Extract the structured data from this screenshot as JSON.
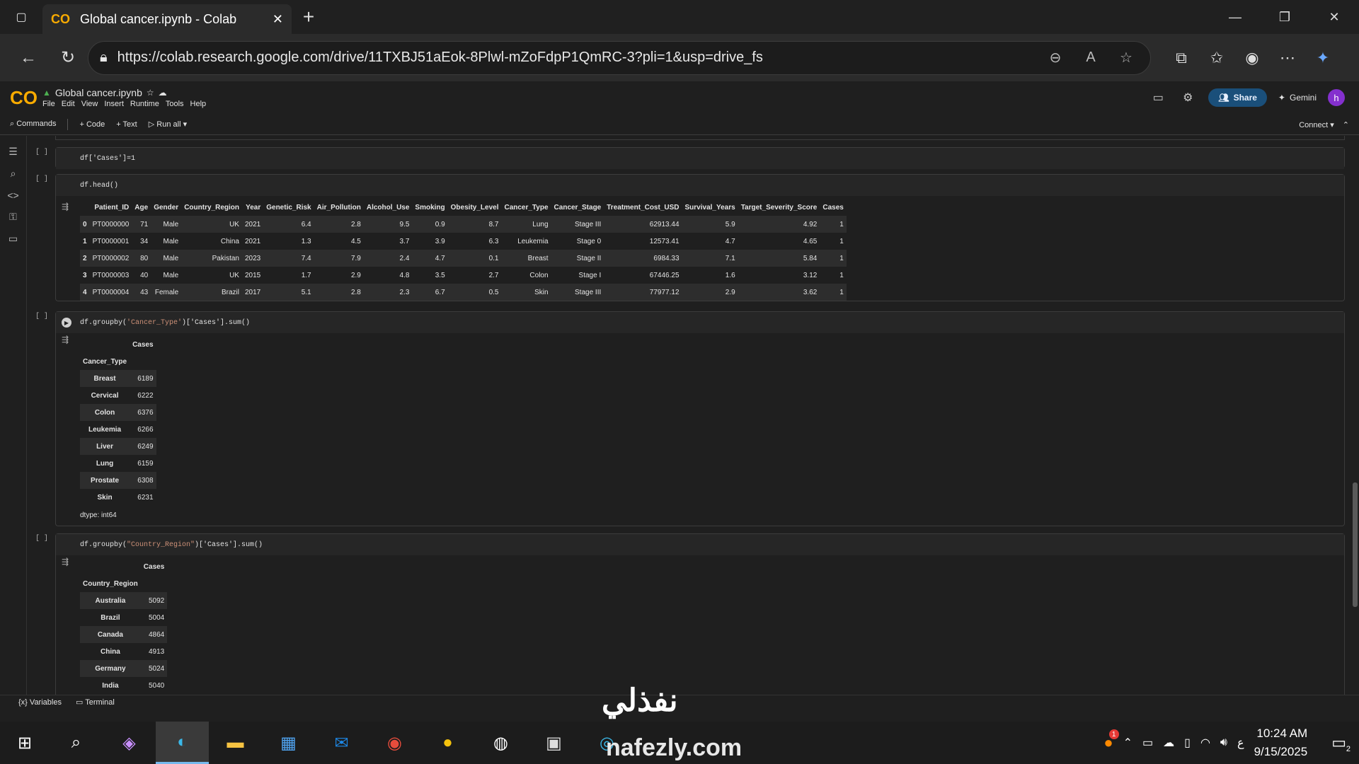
{
  "browser": {
    "tab_title": "Global cancer.ipynb - Colab",
    "url": "https://colab.research.google.com/drive/11TXBJ51aEok-8Plwl-mZoFdpP1QmRC-3?pli=1&usp=drive_fs"
  },
  "colab": {
    "notebook_name": "Global cancer.ipynb",
    "menus": [
      "File",
      "Edit",
      "View",
      "Insert",
      "Runtime",
      "Tools",
      "Help"
    ],
    "share_label": "Share",
    "gemini_label": "Gemini",
    "avatar_letter": "h",
    "toolbar": {
      "commands": "Commands",
      "code": "+ Code",
      "text": "+ Text",
      "run_all": "Run all",
      "connect": "Connect"
    }
  },
  "cells": {
    "c1": {
      "bracket": "[ ]",
      "code": "df['Cases']=1"
    },
    "c2": {
      "bracket": "[ ]",
      "code": "df.head()",
      "columns": [
        "",
        "Patient_ID",
        "Age",
        "Gender",
        "Country_Region",
        "Year",
        "Genetic_Risk",
        "Air_Pollution",
        "Alcohol_Use",
        "Smoking",
        "Obesity_Level",
        "Cancer_Type",
        "Cancer_Stage",
        "Treatment_Cost_USD",
        "Survival_Years",
        "Target_Severity_Score",
        "Cases"
      ],
      "rows": [
        [
          "0",
          "PT0000000",
          "71",
          "Male",
          "UK",
          "2021",
          "6.4",
          "2.8",
          "9.5",
          "0.9",
          "8.7",
          "Lung",
          "Stage III",
          "62913.44",
          "5.9",
          "4.92",
          "1"
        ],
        [
          "1",
          "PT0000001",
          "34",
          "Male",
          "China",
          "2021",
          "1.3",
          "4.5",
          "3.7",
          "3.9",
          "6.3",
          "Leukemia",
          "Stage 0",
          "12573.41",
          "4.7",
          "4.65",
          "1"
        ],
        [
          "2",
          "PT0000002",
          "80",
          "Male",
          "Pakistan",
          "2023",
          "7.4",
          "7.9",
          "2.4",
          "4.7",
          "0.1",
          "Breast",
          "Stage II",
          "6984.33",
          "7.1",
          "5.84",
          "1"
        ],
        [
          "3",
          "PT0000003",
          "40",
          "Male",
          "UK",
          "2015",
          "1.7",
          "2.9",
          "4.8",
          "3.5",
          "2.7",
          "Colon",
          "Stage I",
          "67446.25",
          "1.6",
          "3.12",
          "1"
        ],
        [
          "4",
          "PT0000004",
          "43",
          "Female",
          "Brazil",
          "2017",
          "5.1",
          "2.8",
          "2.3",
          "6.7",
          "0.5",
          "Skin",
          "Stage III",
          "77977.12",
          "2.9",
          "3.62",
          "1"
        ]
      ]
    },
    "c3": {
      "bracket": "[ ]",
      "code_pre": "df.groupby(",
      "code_str": "'Cancer_Type'",
      "code_post": ")['Cases'].sum()",
      "col": "Cases",
      "index_name": "Cancer_Type",
      "rows": [
        [
          "Breast",
          "6189"
        ],
        [
          "Cervical",
          "6222"
        ],
        [
          "Colon",
          "6376"
        ],
        [
          "Leukemia",
          "6266"
        ],
        [
          "Liver",
          "6249"
        ],
        [
          "Lung",
          "6159"
        ],
        [
          "Prostate",
          "6308"
        ],
        [
          "Skin",
          "6231"
        ]
      ],
      "dtype": "dtype: int64"
    },
    "c4": {
      "bracket": "[ ]",
      "code_pre": "df.groupby(",
      "code_str": "\"Country_Region\"",
      "code_post": ")['Cases'].sum()",
      "col": "Cases",
      "index_name": "Country_Region",
      "rows": [
        [
          "Australia",
          "5092"
        ],
        [
          "Brazil",
          "5004"
        ],
        [
          "Canada",
          "4864"
        ],
        [
          "China",
          "4913"
        ],
        [
          "Germany",
          "5024"
        ],
        [
          "India",
          "5040"
        ]
      ]
    }
  },
  "statusbar": {
    "variables": "Variables",
    "terminal": "Terminal"
  },
  "taskbar": {
    "time": "10:24 AM",
    "date": "9/15/2025",
    "notif_badge": "1",
    "chat_badge": "2",
    "lang": "ع"
  },
  "watermark": {
    "arabic": "نفذلي",
    "latin": "nafezly.com"
  }
}
